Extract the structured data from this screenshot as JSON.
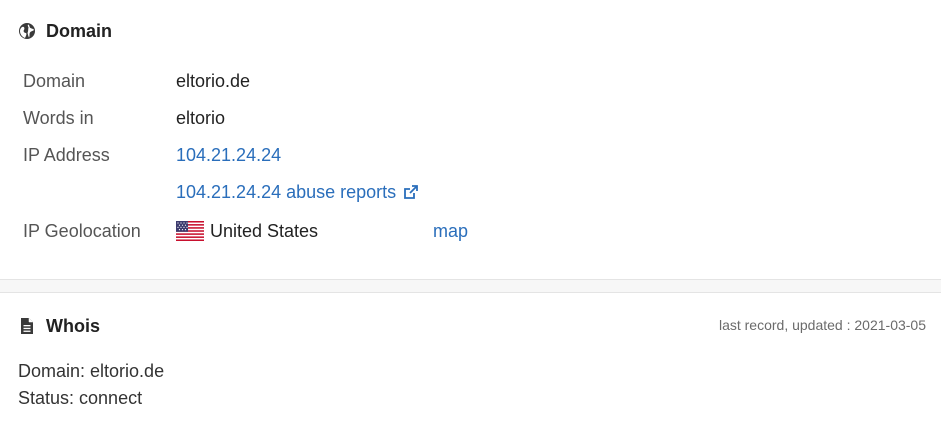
{
  "domain_section": {
    "title": "Domain",
    "icon": "globe-icon",
    "rows": {
      "domain": {
        "label": "Domain",
        "value": "eltorio.de"
      },
      "words": {
        "label": "Words in",
        "value": "eltorio"
      },
      "ip": {
        "label": "IP Address",
        "value": "104.21.24.24",
        "abuse_link": "104.21.24.24 abuse reports",
        "abuse_icon": "external-link-icon"
      },
      "geo": {
        "label": "IP Geolocation",
        "country": "United States",
        "flag_icon": "us-flag-icon",
        "map_link": "map"
      }
    }
  },
  "whois_section": {
    "title": "Whois",
    "icon": "document-icon",
    "last_record": "last record, updated : 2021-03-05",
    "lines": [
      "Domain: eltorio.de",
      "Status: connect"
    ]
  },
  "colors": {
    "link": "#2a6ebb",
    "text": "#333333",
    "label": "#555555",
    "divider": "#f7f7f7"
  }
}
